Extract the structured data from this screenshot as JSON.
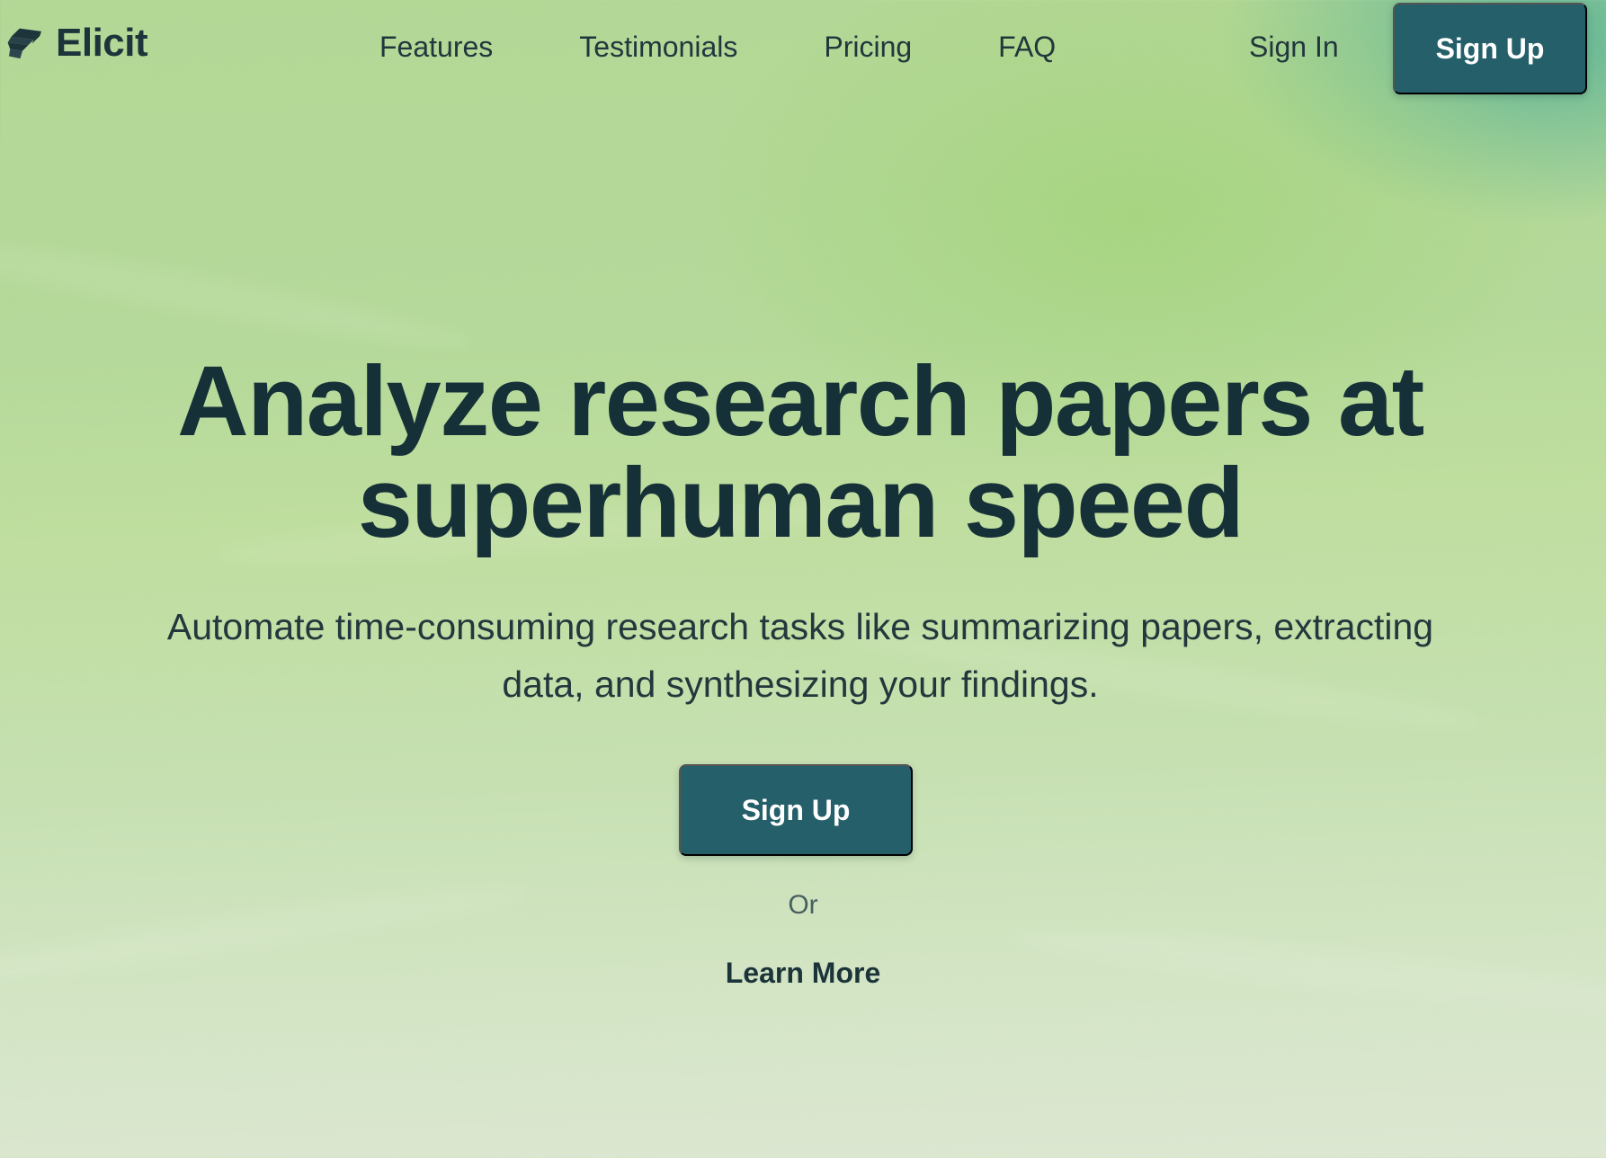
{
  "header": {
    "brand": {
      "name": "Elicit",
      "icon": "elicit-logo-icon"
    },
    "nav_links": [
      {
        "label": "Features"
      },
      {
        "label": "Testimonials"
      },
      {
        "label": "Pricing"
      },
      {
        "label": "FAQ"
      }
    ],
    "sign_in_label": "Sign In",
    "sign_up_label": "Sign Up"
  },
  "hero": {
    "title": "Analyze research papers at superhuman speed",
    "subtitle": "Automate time-consuming research tasks like summarizing papers, extracting data, and synthesizing your findings.",
    "sign_up_label": "Sign Up",
    "or_text": "Or",
    "learn_more_label": "Learn More"
  },
  "colors": {
    "primary_button": "#245F6A",
    "heading_text": "#163038",
    "body_text": "#22383D",
    "background_top": "#B3D795",
    "background_bottom": "#DDE7D2"
  }
}
